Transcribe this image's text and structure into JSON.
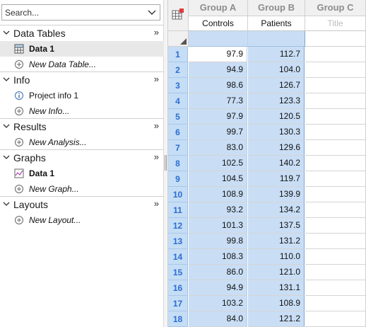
{
  "search": {
    "placeholder": "Search..."
  },
  "navigator": {
    "sections": [
      {
        "title": "Data Tables",
        "items": [
          {
            "label": "Data 1",
            "icon": "table-icon",
            "style": "bold",
            "selected": true
          },
          {
            "label": "New Data Table...",
            "icon": "add-circle-icon",
            "style": "italic"
          }
        ]
      },
      {
        "title": "Info",
        "items": [
          {
            "label": "Project info 1",
            "icon": "info-circle-icon",
            "style": "normal"
          },
          {
            "label": "New Info...",
            "icon": "add-circle-icon",
            "style": "italic"
          }
        ]
      },
      {
        "title": "Results",
        "items": [
          {
            "label": "New Analysis...",
            "icon": "add-circle-icon",
            "style": "italic"
          }
        ]
      },
      {
        "title": "Graphs",
        "items": [
          {
            "label": "Data 1",
            "icon": "graph-icon",
            "style": "bold"
          },
          {
            "label": "New Graph...",
            "icon": "add-circle-icon",
            "style": "italic"
          }
        ]
      },
      {
        "title": "Layouts",
        "items": [
          {
            "label": "New Layout...",
            "icon": "add-circle-icon",
            "style": "italic"
          }
        ]
      }
    ],
    "more_glyph": "»"
  },
  "sheet": {
    "columns": [
      {
        "group": "Group A",
        "title": "Controls"
      },
      {
        "group": "Group B",
        "title": "Patients"
      },
      {
        "group": "Group C",
        "title": "Title",
        "placeholder": true
      }
    ],
    "rows": [
      {
        "n": "1",
        "a": "97.9",
        "b": "112.7"
      },
      {
        "n": "2",
        "a": "94.9",
        "b": "104.0"
      },
      {
        "n": "3",
        "a": "98.6",
        "b": "126.7"
      },
      {
        "n": "4",
        "a": "77.3",
        "b": "123.3"
      },
      {
        "n": "5",
        "a": "97.9",
        "b": "120.5"
      },
      {
        "n": "6",
        "a": "99.7",
        "b": "130.3"
      },
      {
        "n": "7",
        "a": "83.0",
        "b": "129.6"
      },
      {
        "n": "8",
        "a": "102.5",
        "b": "140.2"
      },
      {
        "n": "9",
        "a": "104.5",
        "b": "119.7"
      },
      {
        "n": "10",
        "a": "108.9",
        "b": "139.9"
      },
      {
        "n": "11",
        "a": "93.2",
        "b": "134.2"
      },
      {
        "n": "12",
        "a": "101.3",
        "b": "137.5"
      },
      {
        "n": "13",
        "a": "99.8",
        "b": "131.2"
      },
      {
        "n": "14",
        "a": "108.3",
        "b": "110.0"
      },
      {
        "n": "15",
        "a": "86.0",
        "b": "121.0"
      },
      {
        "n": "16",
        "a": "94.9",
        "b": "131.1"
      },
      {
        "n": "17",
        "a": "103.2",
        "b": "108.9"
      },
      {
        "n": "18",
        "a": "84.0",
        "b": "121.2"
      }
    ]
  },
  "colors": {
    "selection": "#c9def5",
    "row_number": "#2a6ed4",
    "row_header_bg": "#c5ddf5",
    "header_text": "#8c8c8c"
  }
}
